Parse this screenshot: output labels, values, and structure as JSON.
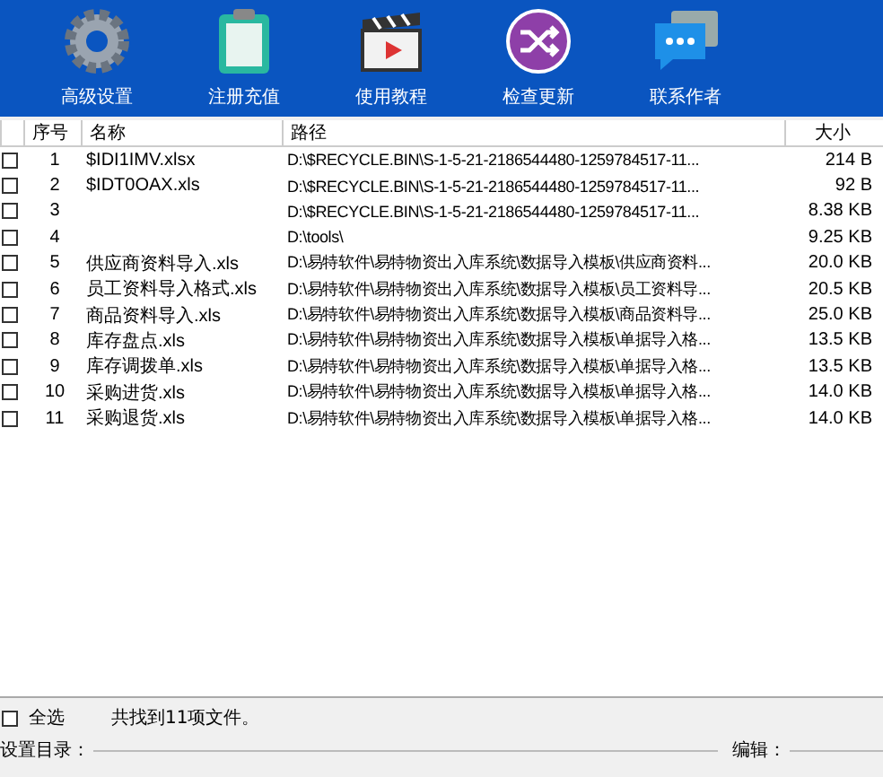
{
  "toolbar": [
    {
      "label": "高级设置"
    },
    {
      "label": "注册充值"
    },
    {
      "label": "使用教程"
    },
    {
      "label": "检查更新"
    },
    {
      "label": "联系作者"
    }
  ],
  "table": {
    "columns": [
      "序号",
      "名称",
      "路径",
      "大小"
    ],
    "rows": [
      {
        "checked": false,
        "index": "1",
        "name": "$IDI1IMV.xlsx",
        "path": "D:\\$RECYCLE.BIN\\S-1-5-21-2186544480-1259784517-11...",
        "size": "214 B"
      },
      {
        "checked": false,
        "index": "2",
        "name": "$IDT0OAX.xls",
        "path": "D:\\$RECYCLE.BIN\\S-1-5-21-2186544480-1259784517-11...",
        "size": "92 B"
      },
      {
        "checked": false,
        "index": "3",
        "path": "D:\\$RECYCLE.BIN\\S-1-5-21-2186544480-1259784517-11...",
        "size": "8.38 KB"
      },
      {
        "checked": false,
        "index": "4",
        "path": "D:\\tools\\",
        "size": "9.25 KB"
      },
      {
        "checked": false,
        "index": "5",
        "name": "供应商资料导入.xls",
        "path": "D:\\易特软件\\易特物资出入库系统\\数据导入模板\\供应商资料...",
        "size": "20.0 KB"
      },
      {
        "checked": false,
        "index": "6",
        "name": "员工资料导入格式.xls",
        "path": "D:\\易特软件\\易特物资出入库系统\\数据导入模板\\员工资料导...",
        "size": "20.5 KB"
      },
      {
        "checked": false,
        "index": "7",
        "name": "商品资料导入.xls",
        "path": "D:\\易特软件\\易特物资出入库系统\\数据导入模板\\商品资料导...",
        "size": "25.0 KB"
      },
      {
        "checked": false,
        "index": "8",
        "name": "库存盘点.xls",
        "path": "D:\\易特软件\\易特物资出入库系统\\数据导入模板\\单据导入格...",
        "size": "13.5 KB"
      },
      {
        "checked": false,
        "index": "9",
        "name": "库存调拨单.xls",
        "path": "D:\\易特软件\\易特物资出入库系统\\数据导入模板\\单据导入格...",
        "size": "13.5 KB"
      },
      {
        "checked": false,
        "index": "10",
        "name": "采购进货.xls",
        "path": "D:\\易特软件\\易特物资出入库系统\\数据导入模板\\单据导入格...",
        "size": "14.0 KB"
      },
      {
        "checked": false,
        "index": "11",
        "name": "采购退货.xls",
        "path": "D:\\易特软件\\易特物资出入库系统\\数据导入模板\\单据导入格...",
        "size": "14.0 KB"
      }
    ]
  },
  "select_all": {
    "label": "全选",
    "checked": false
  },
  "status": "共找到11项文件。",
  "groups": [
    "设置目录：",
    "编辑："
  ]
}
